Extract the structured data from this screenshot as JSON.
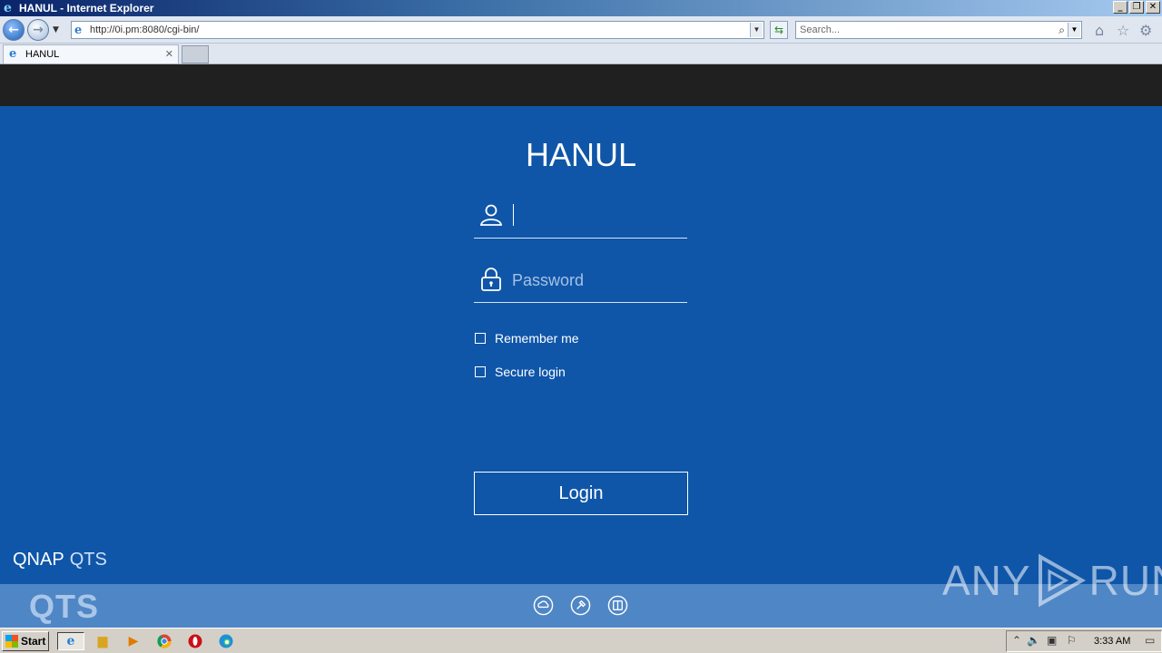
{
  "window": {
    "title": "HANUL - Internet Explorer"
  },
  "browser": {
    "url": "http://0i.pm:8080/cgi-bin/",
    "search_placeholder": "Search...",
    "tab_label": "HANUL"
  },
  "login": {
    "server_name": "HANUL",
    "username_value": "",
    "password_placeholder": "Password",
    "remember_label": "Remember me",
    "secure_label": "Secure login",
    "login_button": "Login"
  },
  "brand": {
    "qnap": "QNAP",
    "qts": "QTS",
    "footer_logo": "QTS"
  },
  "watermark": {
    "left": "ANY",
    "right": "RUN"
  },
  "taskbar": {
    "start_label": "Start",
    "clock": "3:33 AM"
  },
  "colors": {
    "page_bg": "#0f56a9",
    "header_bg": "#202020",
    "footer_bg": "#4f86c6"
  }
}
